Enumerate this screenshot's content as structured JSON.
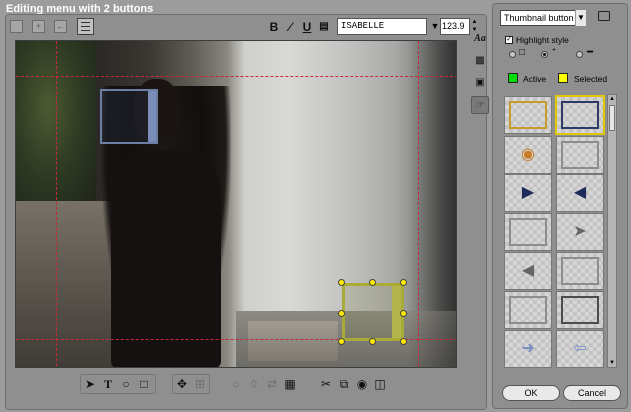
{
  "window": {
    "title": "Editing menu with 2 buttons"
  },
  "toolbar_top": {
    "font_name": "ISABELLE",
    "font_size": "123.9",
    "bold_label": "B",
    "italic_label": "I",
    "underline_label": "U"
  },
  "side_tools": {
    "text_style_label": "Aa"
  },
  "right_panel": {
    "button_type": "Thumbnail button",
    "highlight_style_label": "Highlight style",
    "active_label": "Active",
    "selected_label": "Selected",
    "active_color": "#00dd00",
    "selected_color": "#ffff00"
  },
  "dialog": {
    "ok_label": "OK",
    "cancel_label": "Cancel"
  },
  "icons": [
    "bold-icon",
    "italic-icon",
    "underline-icon",
    "shadow-icon",
    "pointer-icon",
    "text-tool-icon",
    "circle-tool-icon",
    "rect-tool-icon",
    "move-icon",
    "align-icon",
    "cut-icon",
    "copy-icon",
    "paste-icon",
    "trash-icon",
    "folder-icon"
  ]
}
